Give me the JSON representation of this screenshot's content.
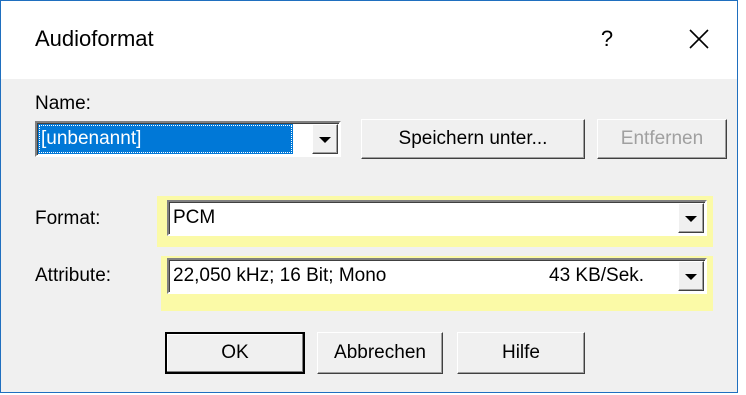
{
  "window": {
    "title": "Audioformat",
    "help_label": "?",
    "close_label": "Close"
  },
  "name": {
    "label": "Name:",
    "value": "[unbenannt]",
    "save_as_label": "Speichern unter...",
    "remove_label": "Entfernen"
  },
  "format": {
    "label": "Format:",
    "value": "PCM"
  },
  "attribute": {
    "label": "Attribute:",
    "value": "22,050 kHz; 16 Bit; Mono",
    "rate": "43 KB/Sek."
  },
  "buttons": {
    "ok": "OK",
    "cancel": "Abbrechen",
    "help": "Hilfe"
  },
  "colors": {
    "selection": "#0078d7",
    "highlight": "#fdfb9a",
    "window_border": "#1f6fbf"
  },
  "icons": {
    "close": "close-icon",
    "dropdown": "chevron-down-icon"
  }
}
